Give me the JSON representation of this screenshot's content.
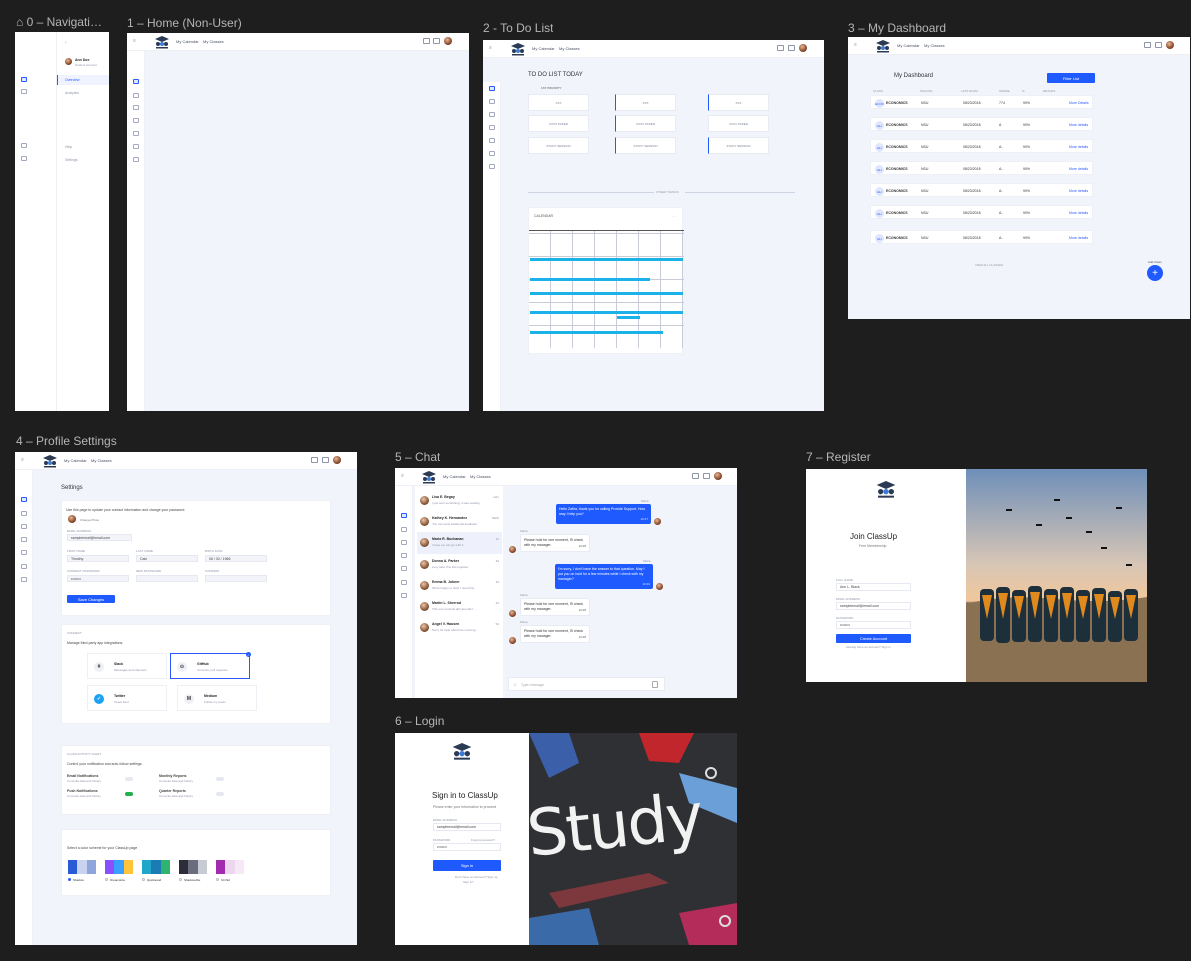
{
  "frames": {
    "nav": {
      "title": "0 – Navigati…",
      "user_name": "Ann Doe",
      "user_role": "Student Account",
      "menu": [
        "Overview",
        "Analytics",
        "Help",
        "Settings"
      ]
    },
    "home": {
      "title": "1 – Home (Non-User)",
      "links": [
        "My Calendar",
        "My Classes"
      ]
    },
    "todo": {
      "title": "2 - To Do List",
      "links": [
        "My Calendar",
        "My Classes"
      ],
      "heading": "TO DO LIST TODAY",
      "first_priority": "1ST PRIORITY",
      "items": [
        [
          "XXX",
          "XXX",
          "XXX"
        ],
        [
          "XXXX PAPER",
          "XXXX PAPER",
          "XXXX PAPER"
        ],
        [
          "STUDY SESSION",
          "STUDY SESSION",
          "STUDY SESSION"
        ]
      ],
      "divider": "OTHER THINGS",
      "cal_title": "CALENDAR"
    },
    "dashboard": {
      "title": "3 – My Dashboard",
      "links": [
        "My Calendar",
        "My Classes"
      ],
      "heading": "My Dashboard",
      "filter": "Filter List",
      "columns": [
        "CLASS",
        "SCHOOL",
        "LAST EXAM",
        "GRADE",
        "%",
        "DETAILS"
      ],
      "rows": [
        {
          "badge": "ECON",
          "name": "ECONOMICS",
          "school": "NSU",
          "date": "08/23/2018",
          "grade": "774",
          "pct": "90%",
          "link": "More Details"
        },
        {
          "badge": "EH",
          "name": "ECONOMICS",
          "school": "NSU",
          "date": "08/23/2018",
          "grade": "A",
          "pct": "90%",
          "link": "More details"
        },
        {
          "badge": "EH",
          "name": "ECONOMICS",
          "school": "NSU",
          "date": "08/23/2018",
          "grade": "A-",
          "pct": "90%",
          "link": "More details"
        },
        {
          "badge": "EH",
          "name": "ECONOMICS",
          "school": "NSU",
          "date": "08/23/2018",
          "grade": "A-",
          "pct": "90%",
          "link": "More details"
        },
        {
          "badge": "EH",
          "name": "ECONOMICS",
          "school": "NSU",
          "date": "08/23/2018",
          "grade": "A-",
          "pct": "90%",
          "link": "More details"
        },
        {
          "badge": "EH",
          "name": "ECONOMICS",
          "school": "NSU",
          "date": "08/23/2018",
          "grade": "A-",
          "pct": "90%",
          "link": "More details"
        },
        {
          "badge": "EH",
          "name": "ECONOMICS",
          "school": "NSU",
          "date": "08/23/2018",
          "grade": "A-",
          "pct": "90%",
          "link": "More details"
        }
      ],
      "footer": "VIEW ALL CLASSES",
      "add_label": "Add Class"
    },
    "profile": {
      "title": "4 – Profile Settings",
      "links": [
        "My Calendar",
        "My Classes"
      ],
      "heading": "Settings",
      "intro": "Use this page to update your contact information and change your password.",
      "change_photo": "Change Photo",
      "fields": [
        {
          "label": "EMAIL ADDRESS",
          "value": "sampleemail@email.com"
        },
        {
          "label": "FIRST NAME",
          "value": "Timothy"
        },
        {
          "label": "LAST NAME",
          "value": "Cain"
        },
        {
          "label": "BIRTH DATE",
          "value": "06 / 30 / 1966"
        },
        {
          "label": "CURRENT PASSWORD",
          "value": "••••••••"
        },
        {
          "label": "NEW PASSWORD",
          "value": ""
        },
        {
          "label": "CONFIRM",
          "value": ""
        }
      ],
      "save": "Save Changes",
      "connect_title": "CONNECT",
      "connect_sub": "Manage third-party app integrations.",
      "integrations": [
        {
          "icon": "#",
          "name": "Slack",
          "desc": "Messages and channels"
        },
        {
          "icon": "⊙",
          "name": "GitHub",
          "desc": "Commits, pull requests"
        },
        {
          "icon": "✓",
          "name": "Twitter",
          "desc": "Tweet feed"
        },
        {
          "icon": "M",
          "name": "Medium",
          "desc": "Follow my posts"
        }
      ],
      "notif_title": "CLASS ACTIVITY ALERT",
      "notif_sub": "Control your notification and auto-follow settings.",
      "notifs": [
        {
          "name": "Email Notifications",
          "desc": "Commits data and history"
        },
        {
          "name": "Monthly Reports",
          "desc": "Commits data and history"
        },
        {
          "name": "Push Notifications",
          "desc": "Commits data and history"
        },
        {
          "name": "Quarter Reports",
          "desc": "Commits data and history"
        }
      ],
      "theme_title": "Select a color scheme for your ClassUp page",
      "themes": [
        {
          "name": "Shadow",
          "c": [
            "#2a5bd7",
            "#c9d3ef",
            "#8fa6dc"
          ]
        },
        {
          "name": "Dreamsicle",
          "c": [
            "#8a4fff",
            "#3aa0ff",
            "#ffc43a"
          ]
        },
        {
          "name": "Quicksand",
          "c": [
            "#1fa7c9",
            "#1a7bb5",
            "#2fb36f"
          ]
        },
        {
          "name": "Shadowvibe",
          "c": [
            "#2d2d3a",
            "#6a6d7d",
            "#c8cad4"
          ]
        },
        {
          "name": "Orchid",
          "c": [
            "#a32bb0",
            "#ecd6f0",
            "#f6e8f7"
          ]
        }
      ]
    },
    "chat": {
      "title": "5 – Chat",
      "links": [
        "My Calendar",
        "My Classes"
      ],
      "contacts": [
        {
          "name": "Lisa E. Begay",
          "msg": "I just sent something, it was reading.",
          "time": "12m"
        },
        {
          "name": "Kathey K. Hernandez",
          "msg": "You can send additional feedback.",
          "time": "NEW"
        },
        {
          "name": "Maria R. Buchanan",
          "msg": "I hope we can go with it.",
          "time": "1h"
        },
        {
          "name": "Donna A. Parker",
          "msg": "Lucy said, this this together.",
          "time": "3d"
        },
        {
          "name": "Emma B. Johner",
          "msg": "We're happy to help! I need this.",
          "time": "3d"
        },
        {
          "name": "Martin L. Sherrod",
          "msg": "This one reminds all! How did I…",
          "time": "4d"
        },
        {
          "name": "Angel V. Hausen",
          "msg": "Sorry for hear about the morning.",
          "time": "5d"
        }
      ],
      "messages": [
        {
          "who": "Maria",
          "text": "Hello Zafira, thank you for calling Provide Support. How may I help you?",
          "time": "10:47",
          "me": true
        },
        {
          "who": "Maria",
          "text": "Please hold for one moment, I'll check with my manager.",
          "time": "10:48",
          "me": false
        },
        {
          "who": "Maria",
          "text": "I'm sorry, I don't have the answer to that question. May I put you on hold for a few minutes while I check with my manager?",
          "time": "10:49",
          "me": true
        },
        {
          "who": "Maria",
          "text": "Please hold for one moment, I'll check with my manager.",
          "time": "10:48",
          "me": false
        },
        {
          "who": "Maria",
          "text": "Please hold for one moment, I'll check with my manager.",
          "time": "10:48",
          "me": false
        }
      ],
      "input_placeholder": "Type message"
    },
    "login": {
      "title": "6 – Login",
      "heading": "Sign in to ClassUp",
      "sub": "Please enter your information to proceed",
      "email_label": "EMAIL ADDRESS",
      "email": "sampleemail@email.com",
      "pw_label": "PASSWORD",
      "forgot": "Forgot password?",
      "pw": "••••••••",
      "button": "Sign in",
      "footer": "Don't have an account? Sign up",
      "footer2": "Sign in?",
      "study": "Study"
    },
    "register": {
      "title": "7 – Register",
      "heading": "Join ClassUp",
      "sub": "Free Membership",
      "name_label": "FULL NAME",
      "name": "Ann L. Black",
      "email_label": "EMAIL ADDRESS",
      "email": "sampleemail@email.com",
      "pw_label": "PASSWORD",
      "pw": "••••••••",
      "button": "Create Account",
      "footer": "Already have an account? Sign in"
    }
  }
}
